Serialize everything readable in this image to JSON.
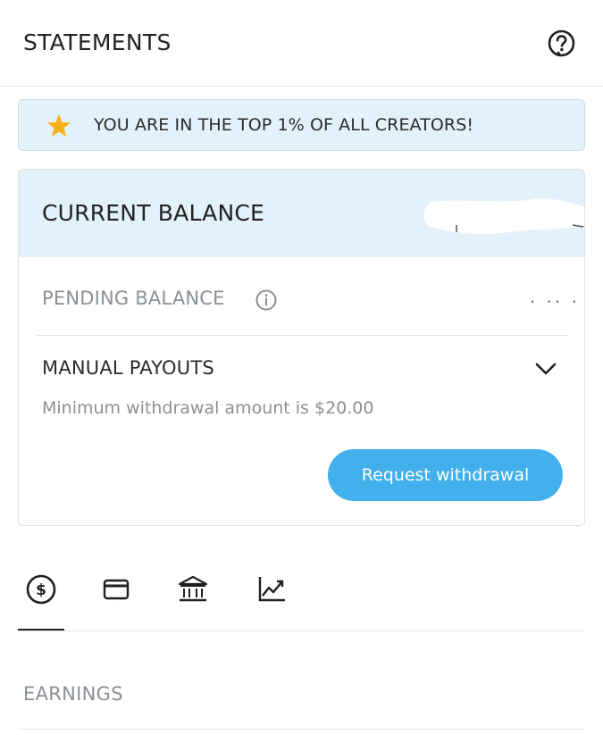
{
  "header": {
    "title": "STATEMENTS",
    "help_icon": "help-icon"
  },
  "banner": {
    "icon": "star-icon",
    "icon_color": "#f6b21b",
    "text": "YOU ARE IN THE TOP 1% OF ALL CREATORS!"
  },
  "balance": {
    "current_label": "CURRENT BALANCE",
    "pending_label": "PENDING BALANCE",
    "pending_value_partial": ". .. .",
    "manual_label": "MANUAL PAYOUTS",
    "min_text": "Minimum withdrawal amount is $20.00",
    "withdraw_label": "Request withdrawal"
  },
  "tabs": [
    {
      "name": "earnings",
      "icon": "dollar-circle-icon",
      "active": true
    },
    {
      "name": "cards",
      "icon": "card-icon",
      "active": false
    },
    {
      "name": "bank",
      "icon": "bank-icon",
      "active": false
    },
    {
      "name": "statistics",
      "icon": "chart-icon",
      "active": false
    }
  ],
  "section": {
    "title": "EARNINGS"
  },
  "colors": {
    "accent": "#41b0ec",
    "banner_bg": "#e2f1fa",
    "muted_text": "#8a9095"
  }
}
